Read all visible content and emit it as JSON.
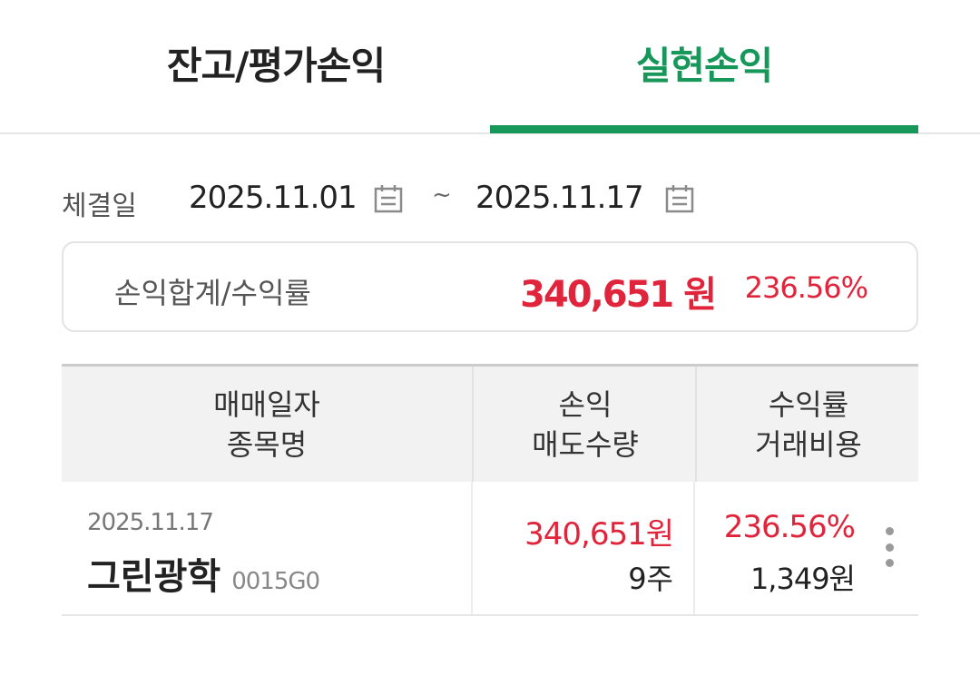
{
  "tabs": [
    {
      "label": "잔고/평가손익",
      "active": false
    },
    {
      "label": "실현손익",
      "active": true
    }
  ],
  "accent_color": "#17985a",
  "loss_gain_color": "#e0243b",
  "date_filter": {
    "label": "체결일",
    "from": "2025.11.01",
    "separator": "~",
    "to": "2025.11.17",
    "icon": "calendar-icon"
  },
  "summary": {
    "label": "손익합계/수익률",
    "amount": "340,651 원",
    "rate": "236.56%"
  },
  "table": {
    "headers": [
      {
        "line1": "매매일자",
        "line2": "종목명"
      },
      {
        "line1": "손익",
        "line2": "매도수량"
      },
      {
        "line1": "수익률",
        "line2": "거래비용"
      }
    ],
    "rows": [
      {
        "date": "2025.11.17",
        "name": "그린광학",
        "code": "0015G0",
        "profit_loss": "340,651원",
        "sell_qty": "9주",
        "rate": "236.56%",
        "cost": "1,349원",
        "more_icon": "more-vertical-icon"
      }
    ]
  }
}
